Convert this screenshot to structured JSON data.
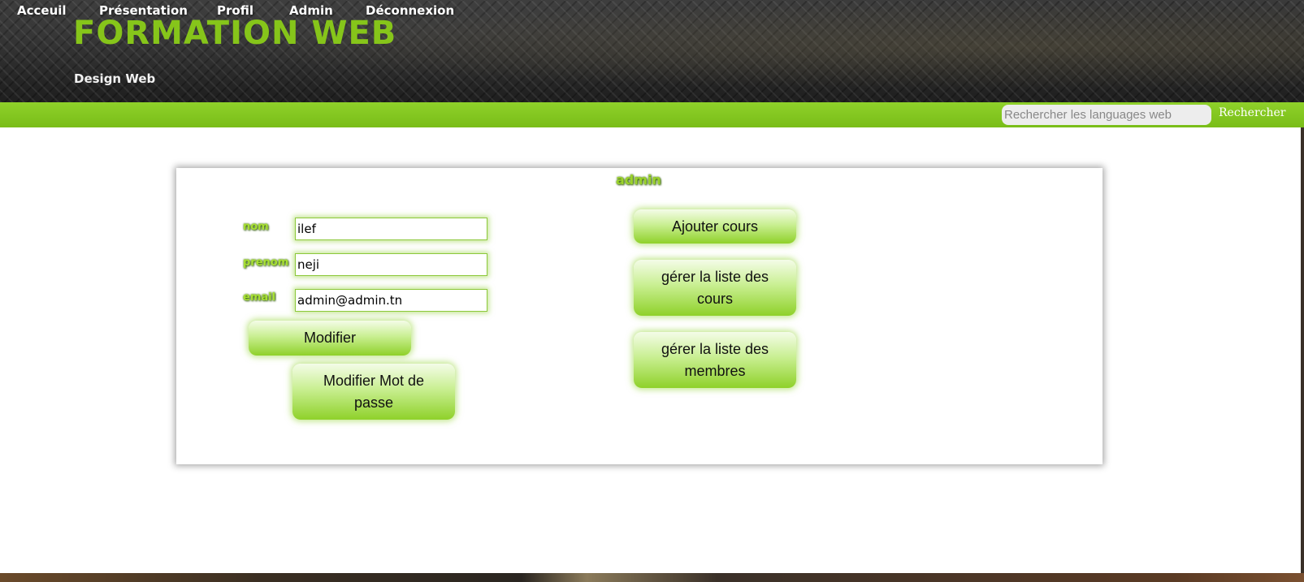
{
  "header": {
    "title": "FORMATION WEB",
    "subtitle": "Design Web"
  },
  "nav": {
    "items": [
      "Acceuil",
      "Présentation",
      "Profil",
      "Admin",
      "Déconnexion"
    ],
    "search_placeholder": "Rechercher les languages web",
    "search_button": "Rechercher"
  },
  "panel": {
    "title": "admin",
    "fields": [
      {
        "label": "nom",
        "value": "ilef"
      },
      {
        "label": "prenom",
        "value": "neji"
      },
      {
        "label": "email",
        "value": "admin@admin.tn"
      }
    ],
    "modifier_button": "Modifier",
    "modifier_password_button": "Modifier Mot de passe",
    "ajouter_cours_button": "Ajouter cours",
    "gerer_cours_button": "gérer la liste des cours",
    "gerer_membres_button": "gérer la liste des membres"
  },
  "colors": {
    "accent": "#86c51a",
    "navbar": "#8fd12a"
  }
}
